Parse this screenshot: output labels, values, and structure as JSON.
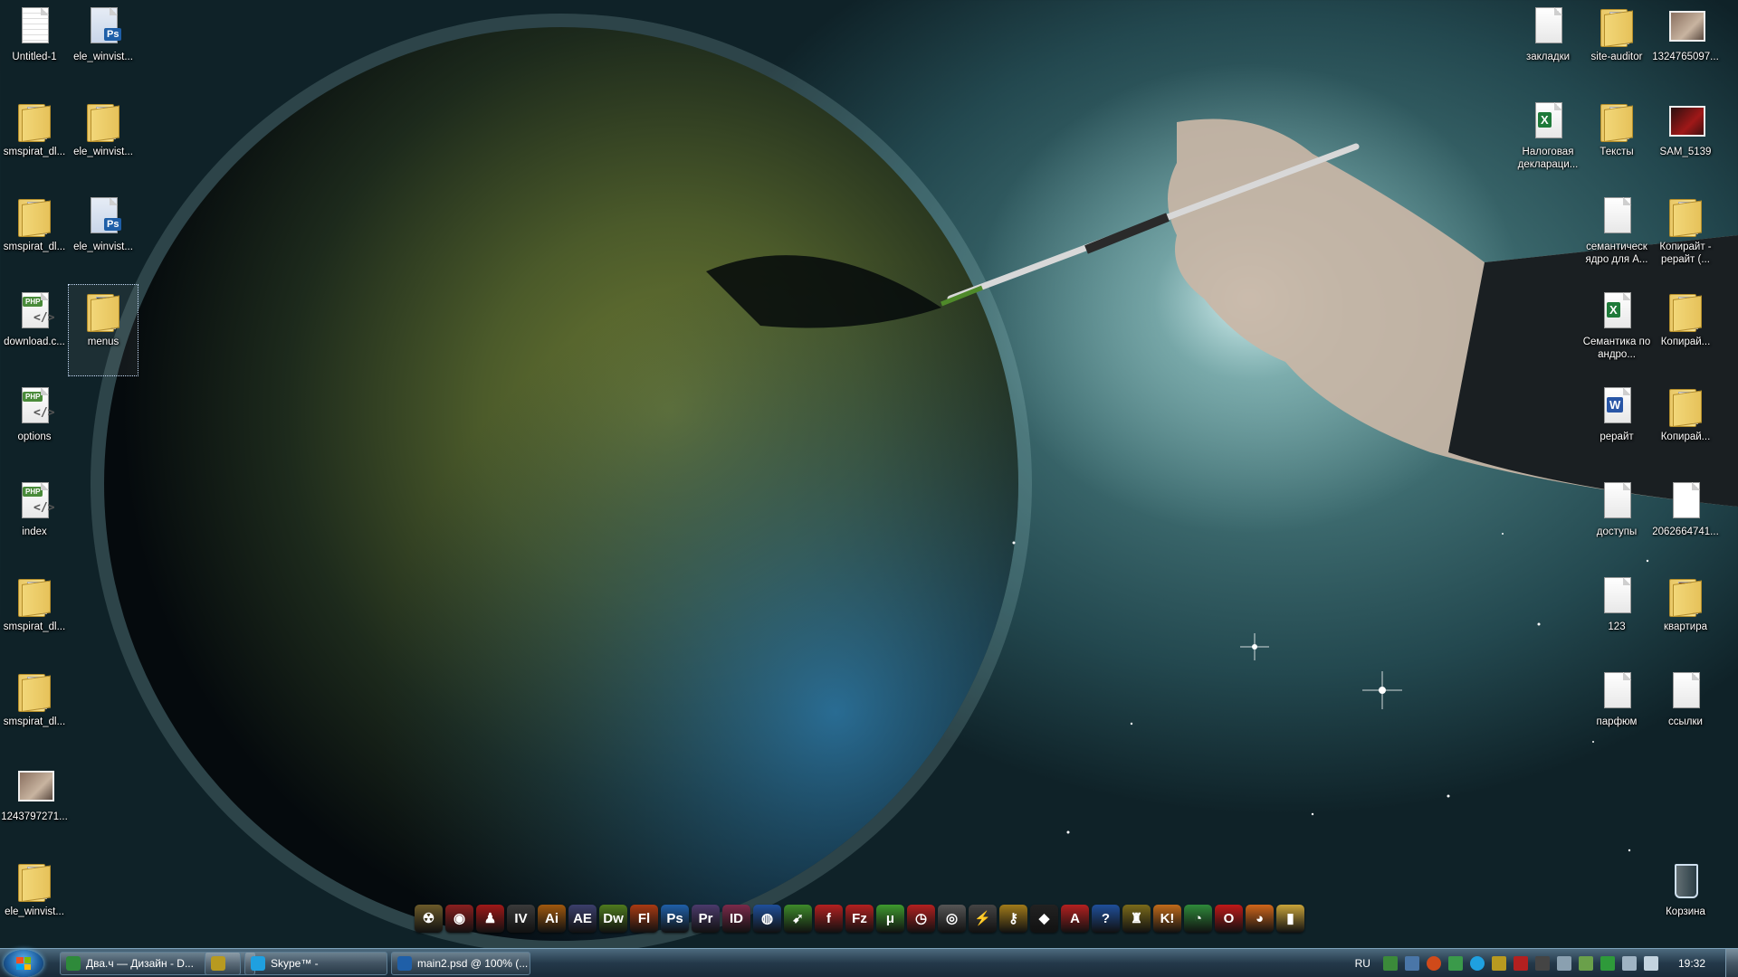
{
  "desktop": {
    "left_icons": [
      {
        "label": "Untitled-1",
        "kind": "doc-grid"
      },
      {
        "label": "ele_winvist...",
        "kind": "psd"
      },
      {
        "label": "smspirat_dl...",
        "kind": "folder"
      },
      {
        "label": "ele_winvist...",
        "kind": "folder"
      },
      {
        "label": "smspirat_dl...",
        "kind": "folder"
      },
      {
        "label": "ele_winvist...",
        "kind": "psd"
      },
      {
        "label": "download.c...",
        "kind": "php"
      },
      {
        "label": "menus",
        "kind": "folder-psd"
      },
      {
        "label": "options",
        "kind": "php"
      },
      {
        "label": "index",
        "kind": "php"
      },
      {
        "label": "smspirat_dl...",
        "kind": "folder"
      },
      {
        "label": "smspirat_dl...",
        "kind": "folder"
      },
      {
        "label": "1243797271...",
        "kind": "photo"
      },
      {
        "label": "ele_winvist...",
        "kind": "folder"
      }
    ],
    "right_icons": [
      {
        "label": "закладки",
        "kind": "doc"
      },
      {
        "label": "site-auditor",
        "kind": "folder"
      },
      {
        "label": "1324765097...",
        "kind": "photo"
      },
      {
        "label": "Налоговая деклараци...",
        "kind": "excel"
      },
      {
        "label": "Тексты",
        "kind": "folder"
      },
      {
        "label": "SAM_5139",
        "kind": "photo-red"
      },
      {
        "label": "семантическ ядро для А...",
        "kind": "doc"
      },
      {
        "label": "Копирайт - рерайт (...",
        "kind": "folder"
      },
      {
        "label": "Семантика по андро...",
        "kind": "excel"
      },
      {
        "label": "Копирай...",
        "kind": "folder"
      },
      {
        "label": "рерайт",
        "kind": "word"
      },
      {
        "label": "Копирай...",
        "kind": "folder"
      },
      {
        "label": "доступы",
        "kind": "doc"
      },
      {
        "label": "2062664741...",
        "kind": "doc-blank"
      },
      {
        "label": "123",
        "kind": "doc"
      },
      {
        "label": "квартира",
        "kind": "folder-photo"
      },
      {
        "label": "парфюм",
        "kind": "doc"
      },
      {
        "label": "ссылки",
        "kind": "doc"
      },
      {
        "label": "Корзина",
        "kind": "trash"
      }
    ]
  },
  "quick_launch": [
    {
      "name": "radiation-icon",
      "text": "☢",
      "color": "#6b5a2a"
    },
    {
      "name": "camera-icon",
      "text": "◉",
      "color": "#8a1f1f"
    },
    {
      "name": "red-app-icon",
      "text": "♟",
      "color": "#a01818"
    },
    {
      "name": "iv-icon",
      "text": "IV",
      "color": "#3a3a3a"
    },
    {
      "name": "illustrator-icon",
      "text": "Ai",
      "color": "#a0580e"
    },
    {
      "name": "after-effects-icon",
      "text": "AE",
      "color": "#3b3f6b"
    },
    {
      "name": "dreamweaver-icon",
      "text": "Dw",
      "color": "#4e7a1e"
    },
    {
      "name": "flash-icon",
      "text": "Fl",
      "color": "#a83a12"
    },
    {
      "name": "photoshop-icon",
      "text": "Ps",
      "color": "#1f5fa8"
    },
    {
      "name": "premiere-icon",
      "text": "Pr",
      "color": "#4b3a6b"
    },
    {
      "name": "indesign-icon",
      "text": "ID",
      "color": "#7a2a4a"
    },
    {
      "name": "globe-icon",
      "text": "◍",
      "color": "#1f4f9a"
    },
    {
      "name": "leaf-icon",
      "text": "➹",
      "color": "#3d8a2a"
    },
    {
      "name": "flash-player-icon",
      "text": "f",
      "color": "#b32020"
    },
    {
      "name": "filezilla-icon",
      "text": "Fz",
      "color": "#b32020"
    },
    {
      "name": "utorrent-icon",
      "text": "μ",
      "color": "#3e9a2e"
    },
    {
      "name": "clock-app-icon",
      "text": "◷",
      "color": "#b32020"
    },
    {
      "name": "disc-icon",
      "text": "◎",
      "color": "#555"
    },
    {
      "name": "winamp-icon",
      "text": "⚡",
      "color": "#444"
    },
    {
      "name": "key-icon",
      "text": "⚷",
      "color": "#a07a1a"
    },
    {
      "name": "batman-icon",
      "text": "◆",
      "color": "#222"
    },
    {
      "name": "acrobat-icon",
      "text": "A",
      "color": "#b32020"
    },
    {
      "name": "help-icon",
      "text": "?",
      "color": "#1f4f9a"
    },
    {
      "name": "robot-icon",
      "text": "♜",
      "color": "#7a6a1a"
    },
    {
      "name": "k-app-icon",
      "text": "K!",
      "color": "#c06a1a"
    },
    {
      "name": "chrome-icon",
      "text": "◔",
      "color": "#2e8a3a"
    },
    {
      "name": "opera-icon",
      "text": "O",
      "color": "#c01818"
    },
    {
      "name": "firefox-icon",
      "text": "◕",
      "color": "#d0661a"
    },
    {
      "name": "folder-icon",
      "text": "▮",
      "color": "#c9a43a"
    }
  ],
  "taskbar": {
    "buttons": [
      {
        "label": "Два.ч — Дизайн - D...",
        "icon": "chrome-icon",
        "icon_color": "#2e8a3a"
      },
      {
        "label": "",
        "icon": "bug-icon",
        "icon_color": "#b89a20"
      },
      {
        "label": "Skype™ -",
        "icon": "skype-icon",
        "icon_color": "#1fa0e0"
      },
      {
        "label": "main2.psd @ 100% (...",
        "icon": "photoshop-icon",
        "icon_color": "#1f5fa8"
      }
    ],
    "language": "RU",
    "clock": "19:32"
  }
}
